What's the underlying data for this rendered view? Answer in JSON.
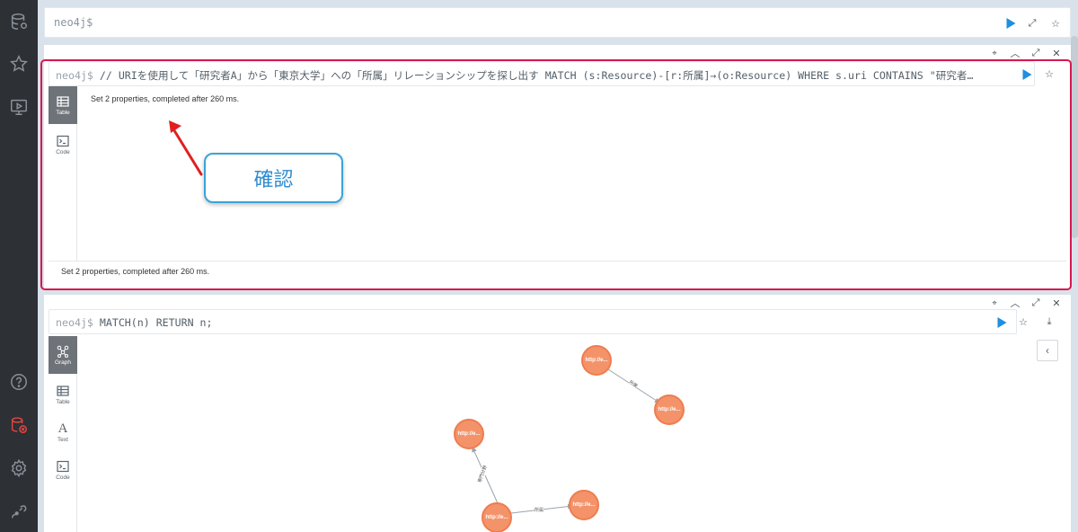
{
  "sidebar": {
    "icons": [
      "database-icon",
      "star-icon",
      "monitor-play-icon",
      "help-icon",
      "disconnect-icon",
      "settings-icon",
      "plug-icon"
    ]
  },
  "editor": {
    "prompt": "neo4j$"
  },
  "frame1": {
    "prompt": "neo4j$",
    "query": "// URIを使用して「研究者A」から「東京大学」への「所属」リレーションシップを探し出す MATCH (s:Resource)-[r:所属]→(o:Resource) WHERE s.uri CONTAINS \"研究者…",
    "tabs": [
      {
        "label": "Table"
      },
      {
        "label": "Code"
      }
    ],
    "result": "Set 2 properties, completed after 260 ms.",
    "status": "Set 2 properties, completed after 260 ms."
  },
  "callout": {
    "text": "確認"
  },
  "frame2": {
    "prompt": "neo4j$",
    "query": "MATCH(n) RETURN n;",
    "tabs": [
      {
        "label": "Graph"
      },
      {
        "label": "Table"
      },
      {
        "label": "Text"
      },
      {
        "label": "Code"
      }
    ],
    "text_tab_glyph": "A",
    "nodes": [
      "http://e...",
      "http://e...",
      "http://e...",
      "http://e...",
      "http://e..."
    ],
    "relationships": [
      "所属",
      "所属",
      "専門分野"
    ]
  },
  "colors": {
    "highlight": "#d6194f",
    "callout_border": "#3aa3d8",
    "node_fill": "#f4936a",
    "run_button": "#1f8fe0"
  }
}
